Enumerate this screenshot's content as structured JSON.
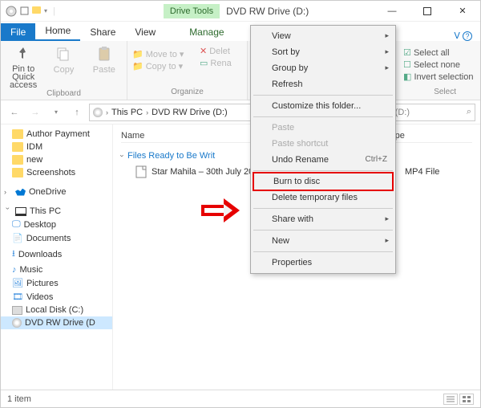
{
  "titlebar": {
    "drive_tools_label": "Drive Tools",
    "app_title": "DVD RW Drive (D:)"
  },
  "tabs": {
    "file": "File",
    "home": "Home",
    "share": "Share",
    "view": "View",
    "manage": "Manage"
  },
  "ribbon": {
    "pin": "Pin to Quick access",
    "copy": "Copy",
    "paste": "Paste",
    "clipboard": "Clipboard",
    "move_to": "Move to",
    "copy_to": "Copy to",
    "delete": "Delet",
    "rename": "Rena",
    "organize": "Organize",
    "select_all": "Select all",
    "select_none": "Select none",
    "invert": "Invert selection",
    "select": "Select"
  },
  "addr": {
    "this_pc": "This PC",
    "drive": "DVD RW Drive (D:)",
    "search_placeholder": "ve (D:)"
  },
  "nav": {
    "author_payment": "Author Payment",
    "idm": "IDM",
    "new": "new",
    "screenshots": "Screenshots",
    "onedrive": "OneDrive",
    "this_pc": "This PC",
    "desktop": "Desktop",
    "documents": "Documents",
    "downloads": "Downloads",
    "music": "Music",
    "pictures": "Pictures",
    "videos": "Videos",
    "local_disk": "Local Disk (C:)",
    "dvd": "DVD RW Drive (D"
  },
  "columns": {
    "name": "Name",
    "type": "Type"
  },
  "section": "Files Ready to Be Writ",
  "file": {
    "name": "Star Mahila – 30th July 20",
    "type": "MP4 File"
  },
  "ctx": {
    "view": "View",
    "sort_by": "Sort by",
    "group_by": "Group by",
    "refresh": "Refresh",
    "customize": "Customize this folder...",
    "paste": "Paste",
    "paste_shortcut": "Paste shortcut",
    "undo_rename": "Undo Rename",
    "undo_shortcut": "Ctrl+Z",
    "burn": "Burn to disc",
    "delete_temp": "Delete temporary files",
    "share_with": "Share with",
    "new": "New",
    "properties": "Properties"
  },
  "status": {
    "count": "1 item"
  }
}
